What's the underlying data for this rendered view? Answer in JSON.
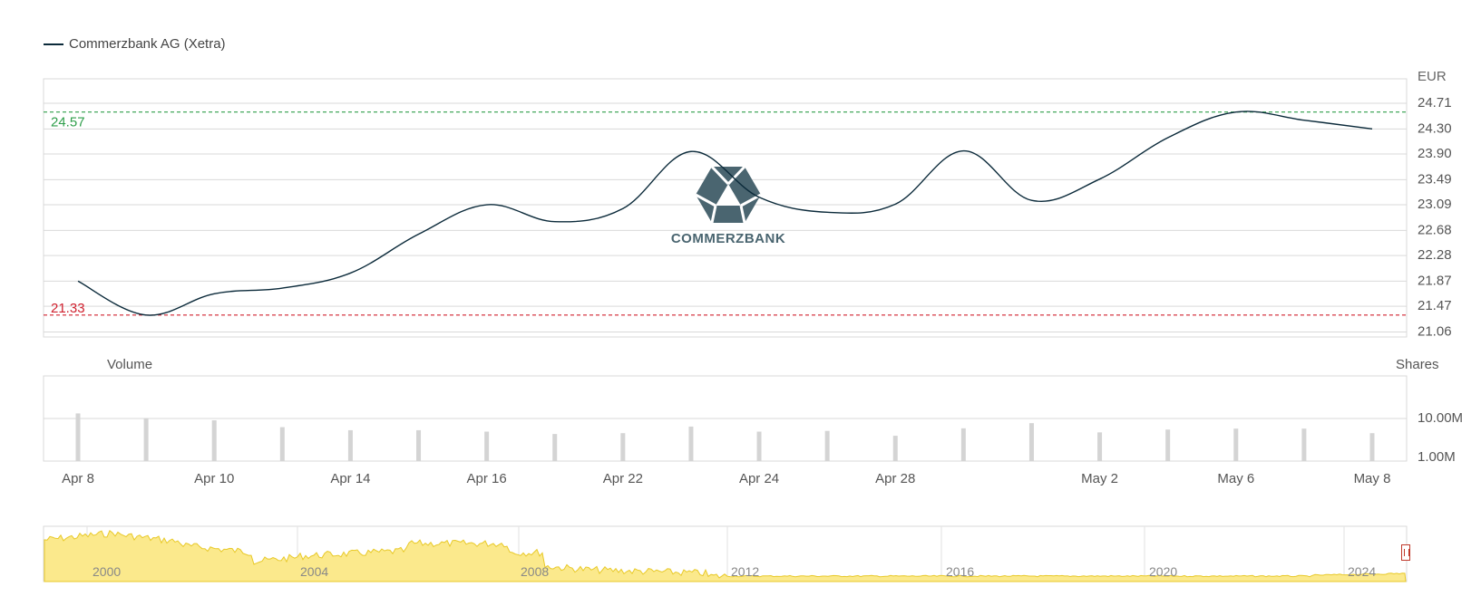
{
  "chart_data": {
    "type": "line",
    "legend": "Commerzbank AG (Xetra)",
    "currency_label": "EUR",
    "price_ticks": [
      24.71,
      24.3,
      23.9,
      23.49,
      23.09,
      22.68,
      22.28,
      21.87,
      21.47,
      21.06
    ],
    "price_ticks_text": [
      "24.71",
      "24.30",
      "23.90",
      "23.49",
      "23.09",
      "22.68",
      "22.28",
      "21.87",
      "21.47",
      "21.06"
    ],
    "ylim": [
      20.98,
      25.1
    ],
    "high_line": {
      "value": 24.57,
      "label": "24.57",
      "color": "#2e9e4a"
    },
    "low_line": {
      "value": 21.33,
      "label": "21.33",
      "color": "#d0202e"
    },
    "line_color": "#0b2a3a",
    "series": [
      {
        "name": "Commerzbank AG (Xetra)",
        "values": [
          21.87,
          21.33,
          21.67,
          21.76,
          22.0,
          22.62,
          23.09,
          22.82,
          23.03,
          23.94,
          23.21,
          22.97,
          23.1,
          23.95,
          23.16,
          23.5,
          24.16,
          24.57,
          24.44,
          24.3
        ]
      }
    ],
    "x_labels": [
      {
        "index": 0,
        "label": "Apr 8"
      },
      {
        "index": 2,
        "label": "Apr 10"
      },
      {
        "index": 4,
        "label": "Apr 14"
      },
      {
        "index": 6,
        "label": "Apr 16"
      },
      {
        "index": 8,
        "label": "Apr 22"
      },
      {
        "index": 10,
        "label": "Apr 24"
      },
      {
        "index": 12,
        "label": "Apr 28"
      },
      {
        "index": 15,
        "label": "May 2"
      },
      {
        "index": 17,
        "label": "May 6"
      },
      {
        "index": 19,
        "label": "May 8"
      }
    ],
    "volume": {
      "title": "Volume",
      "unit_label": "Shares",
      "scale": "log",
      "ticks_text": [
        "10.00M",
        "1.00M"
      ],
      "values_m": [
        13.5,
        10.2,
        9.0,
        6.0,
        5.0,
        5.0,
        4.6,
        4.0,
        4.2,
        6.2,
        4.6,
        4.8,
        3.6,
        5.6,
        7.6,
        4.4,
        5.2,
        5.5,
        5.5,
        4.2
      ]
    },
    "navigator": {
      "year_labels": [
        "2000",
        "2004",
        "2008",
        "2012",
        "2016",
        "2020",
        "2024"
      ],
      "fill_color": "#fbe98c",
      "line_color": "#e8c928"
    },
    "watermark": "COMMERZBANK"
  }
}
